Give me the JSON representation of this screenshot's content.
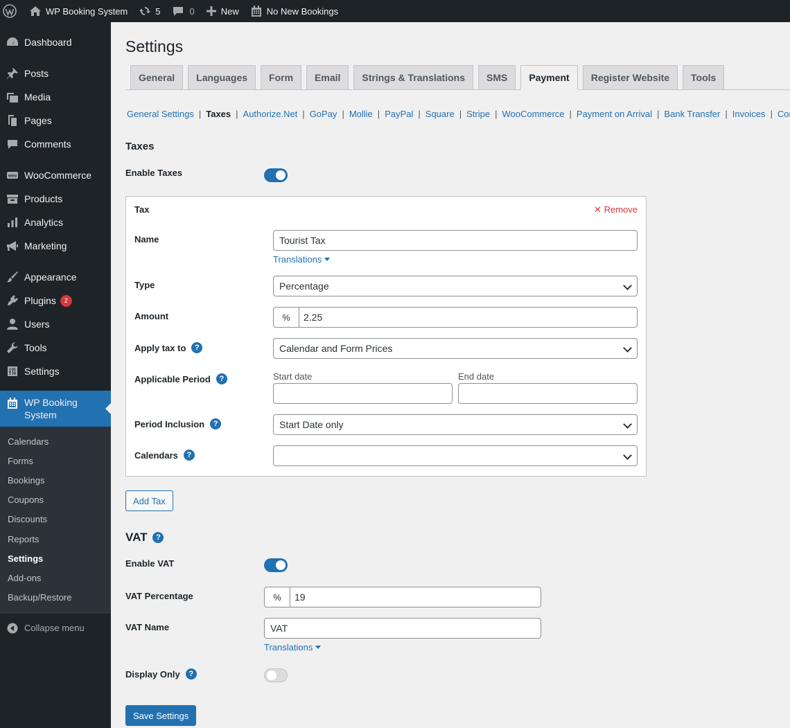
{
  "admin_bar": {
    "site_name": "WP Booking System",
    "updates_count": "5",
    "comments_count": "0",
    "new_label": "New",
    "bookings_label": "No New Bookings"
  },
  "sidebar": {
    "items": [
      {
        "label": "Dashboard",
        "icon": "dashboard-icon"
      },
      {
        "label": "Posts",
        "icon": "pin-icon"
      },
      {
        "label": "Media",
        "icon": "media-icon"
      },
      {
        "label": "Pages",
        "icon": "pages-icon"
      },
      {
        "label": "Comments",
        "icon": "comment-icon"
      },
      {
        "label": "WooCommerce",
        "icon": "woo-icon"
      },
      {
        "label": "Products",
        "icon": "archive-icon"
      },
      {
        "label": "Analytics",
        "icon": "bar-chart-icon"
      },
      {
        "label": "Marketing",
        "icon": "megaphone-icon"
      },
      {
        "label": "Appearance",
        "icon": "brush-icon"
      },
      {
        "label": "Plugins",
        "icon": "plug-icon",
        "badge": "2"
      },
      {
        "label": "Users",
        "icon": "user-icon"
      },
      {
        "label": "Tools",
        "icon": "wrench-icon"
      },
      {
        "label": "Settings",
        "icon": "sliders-icon"
      }
    ],
    "active": {
      "label_line1": "WP Booking",
      "label_line2": "System",
      "icon": "calendar-icon"
    },
    "submenu": [
      "Calendars",
      "Forms",
      "Bookings",
      "Coupons",
      "Discounts",
      "Reports",
      "Settings",
      "Add-ons",
      "Backup/Restore"
    ],
    "collapse_label": "Collapse menu"
  },
  "page": {
    "title": "Settings",
    "tabs": [
      "General",
      "Languages",
      "Form",
      "Email",
      "Strings & Translations",
      "SMS",
      "Payment",
      "Register Website",
      "Tools"
    ],
    "active_tab": "Payment",
    "subnav": [
      "General Settings",
      "Taxes",
      "Authorize.Net",
      "GoPay",
      "Mollie",
      "PayPal",
      "Square",
      "Stripe",
      "WooCommerce",
      "Payment on Arrival",
      "Bank Transfer",
      "Invoices",
      "Contracts"
    ],
    "subnav_current": "Taxes"
  },
  "taxes": {
    "section_title": "Taxes",
    "enable_label": "Enable Taxes",
    "enabled": true,
    "box_title": "Tax",
    "remove_label": "Remove",
    "name_label": "Name",
    "name_value": "Tourist Tax",
    "translations_label": "Translations",
    "type_label": "Type",
    "type_value": "Percentage",
    "amount_label": "Amount",
    "amount_prefix": "%",
    "amount_value": "2.25",
    "apply_label": "Apply tax to",
    "apply_value": "Calendar and Form Prices",
    "period_label": "Applicable Period",
    "start_date_label": "Start date",
    "start_date_value": "",
    "end_date_label": "End date",
    "end_date_value": "",
    "inclusion_label": "Period Inclusion",
    "inclusion_value": "Start Date only",
    "calendars_label": "Calendars",
    "calendars_value": "",
    "add_tax_label": "Add Tax"
  },
  "vat": {
    "section_title": "VAT",
    "enable_label": "Enable VAT",
    "enabled": true,
    "percentage_label": "VAT Percentage",
    "percentage_prefix": "%",
    "percentage_value": "19",
    "name_label": "VAT Name",
    "name_value": "VAT",
    "translations_label": "Translations",
    "display_only_label": "Display Only",
    "display_only": false,
    "save_label": "Save Settings"
  },
  "colors": {
    "accent": "#2271b1",
    "admin_dark": "#1d2327",
    "danger": "#d63638"
  }
}
